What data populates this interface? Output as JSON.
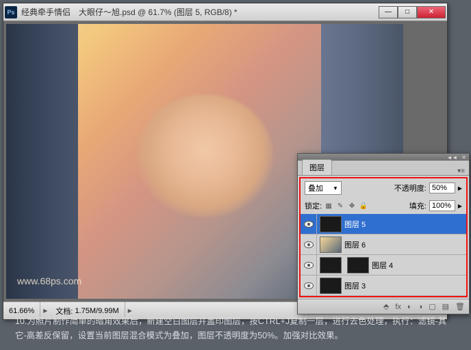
{
  "window": {
    "title": "经典牵手情侣　大眼仔～旭.psd @ 61.7% (图层 5, RGB/8) *",
    "ps_icon": "Ps"
  },
  "canvas": {
    "watermark": "www.68ps.com"
  },
  "status": {
    "zoom": "61.66%",
    "doc_label": "文档:",
    "doc_size": "1.75M/9.99M"
  },
  "layers_panel": {
    "tab": "图层",
    "blend_mode": "叠加",
    "opacity_label": "不透明度:",
    "opacity_value": "50%",
    "lock_label": "锁定:",
    "fill_label": "填充:",
    "fill_value": "100%",
    "layers": [
      {
        "name": "图层 5"
      },
      {
        "name": "图层 6"
      },
      {
        "name": "图层 4"
      },
      {
        "name": "图层 3"
      }
    ]
  },
  "caption": {
    "text": "10.为照片制作简单的暗角效果后，新建空白图层并盖印图层，按CTRL+J复制一层，进行去色处理，执行：滤镜-其它-高差反保留，设置当前图层混合模式为叠加，图层不透明度为50%。加强对比效果。"
  }
}
